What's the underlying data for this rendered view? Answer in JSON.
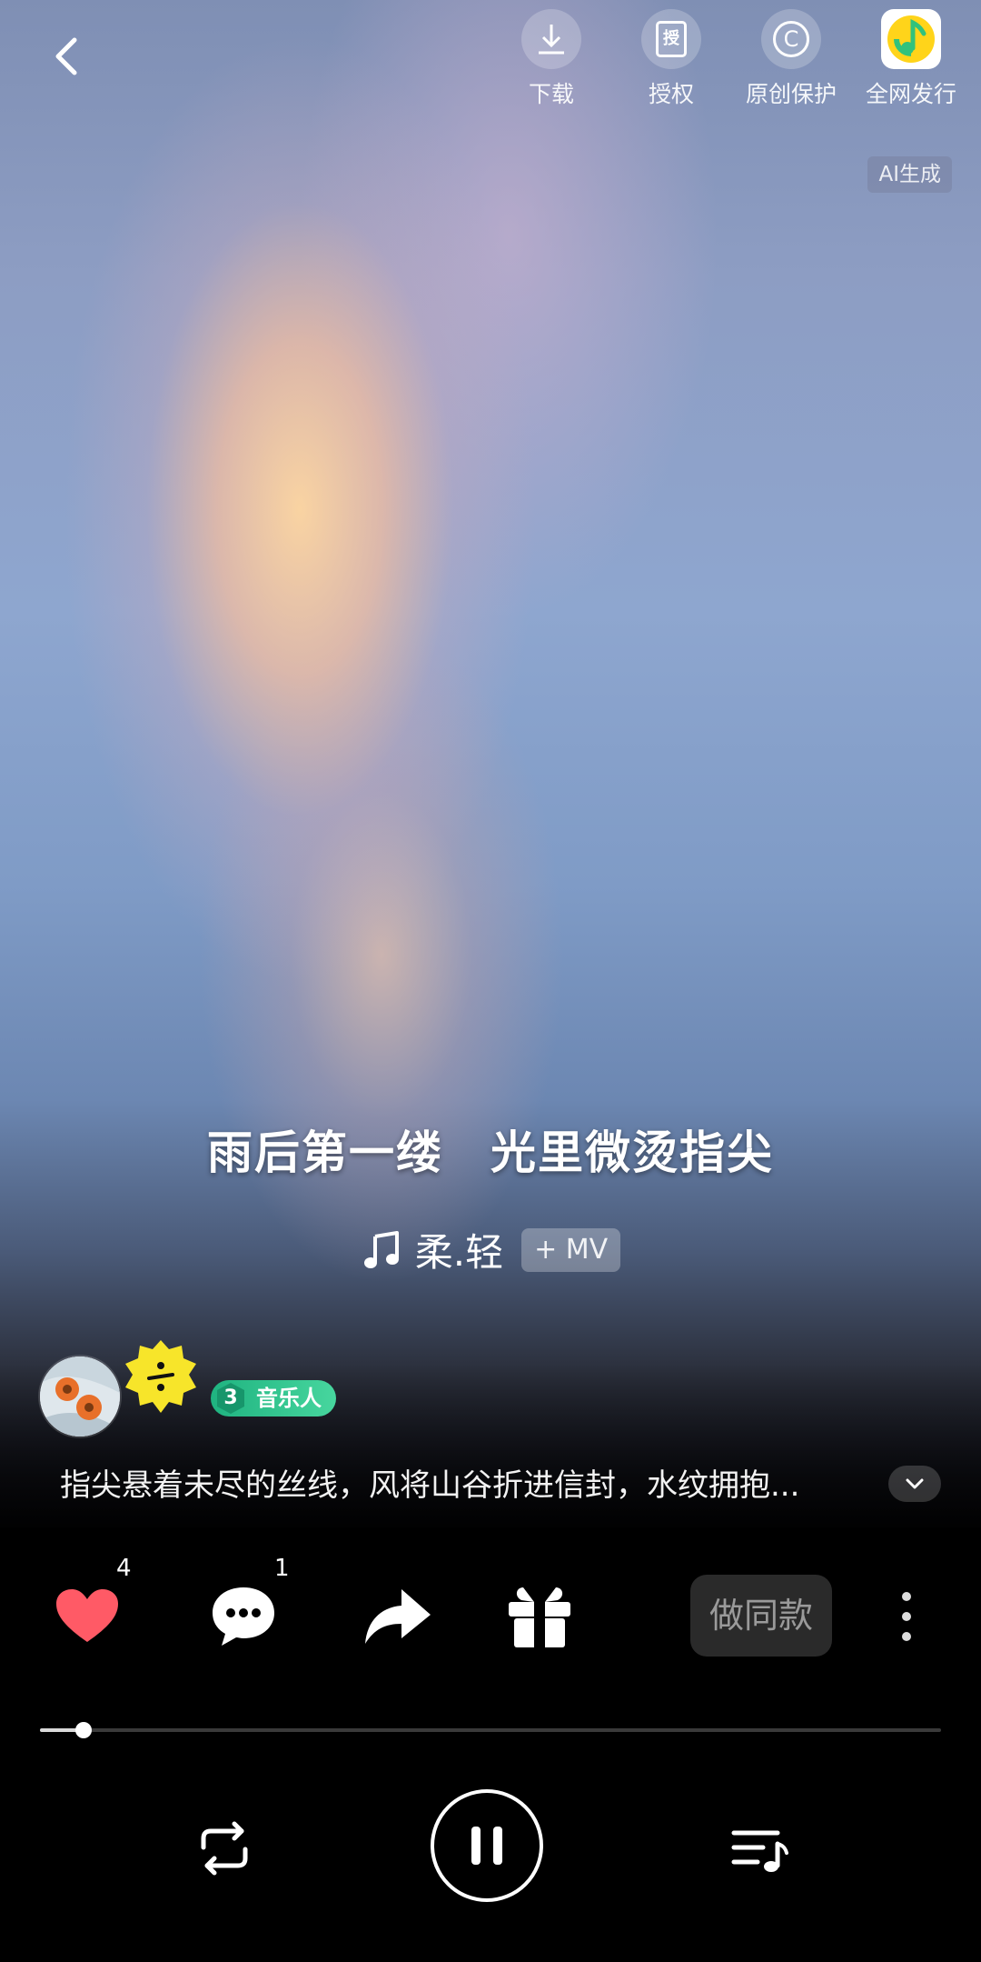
{
  "top_bar": {
    "actions": [
      {
        "label": "下载",
        "icon": "download-icon"
      },
      {
        "label": "授权",
        "icon": "license-icon",
        "glyph": "授"
      },
      {
        "label": "原创保护",
        "icon": "copyright-icon",
        "glyph": "C"
      },
      {
        "label": "全网发行",
        "icon": "qq-music-logo"
      }
    ],
    "ai_badge": "AI生成"
  },
  "lyric": "雨后第一缕　光里微烫指尖",
  "song": {
    "title": "柔.轻",
    "mv_label": "+ MV"
  },
  "author": {
    "level": "3",
    "badge_label": "音乐人",
    "description": "指尖悬着未尽的丝线，风将山谷折进信封，水纹拥抱..."
  },
  "actions": {
    "like_count": "4",
    "comment_count": "1",
    "same_style_label": "做同款"
  },
  "progress": {
    "fraction": 0.048
  },
  "colors": {
    "like": "#ff5a66",
    "musician_badge": "#2fc48c",
    "author_badge": "#f7e52a"
  }
}
